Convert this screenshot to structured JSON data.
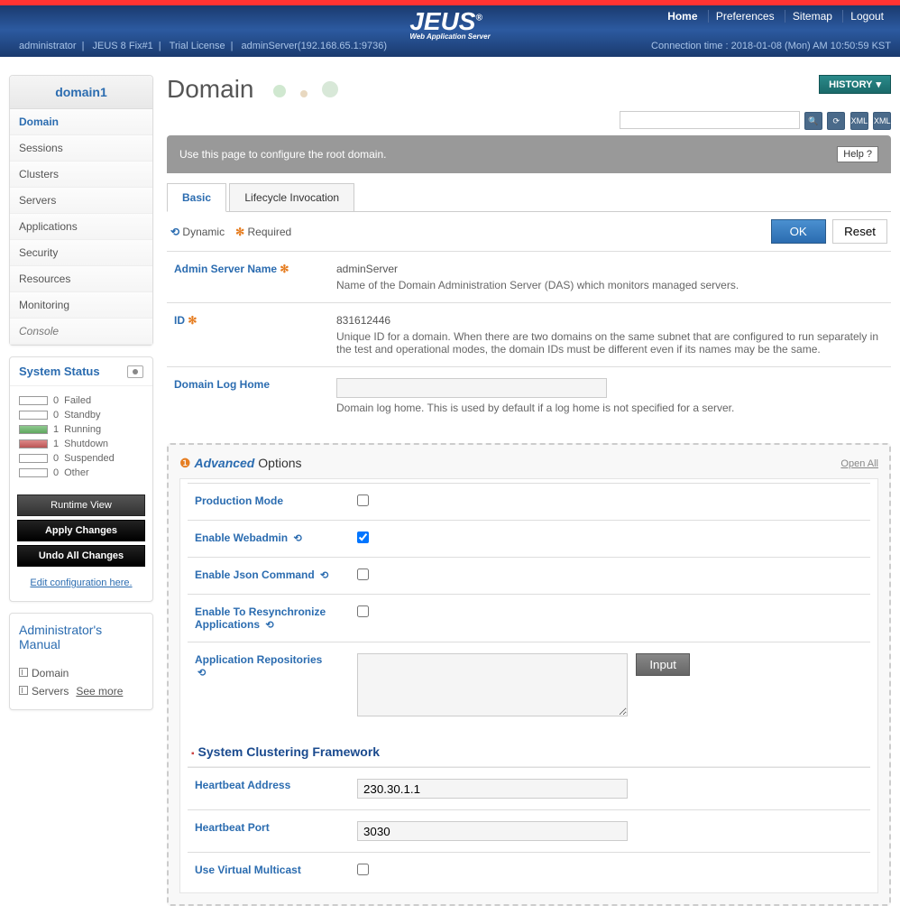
{
  "header": {
    "nav": {
      "home": "Home",
      "preferences": "Preferences",
      "sitemap": "Sitemap",
      "logout": "Logout"
    },
    "logo": "JEUS",
    "logo_sub": "Web Application Server",
    "breadcrumb": {
      "user": "administrator",
      "version": "JEUS 8 Fix#1",
      "license": "Trial License",
      "server": "adminServer(192.168.65.1:9736)"
    },
    "conn_time": "Connection time : 2018-01-08 (Mon) AM 10:50:59 KST"
  },
  "sidebar": {
    "title": "domain1",
    "items": [
      "Domain",
      "Sessions",
      "Clusters",
      "Servers",
      "Applications",
      "Security",
      "Resources",
      "Monitoring",
      "Console"
    ],
    "system_status": {
      "title": "System Status",
      "rows": [
        {
          "count": "0",
          "label": "Failed",
          "color": ""
        },
        {
          "count": "0",
          "label": "Standby",
          "color": ""
        },
        {
          "count": "1",
          "label": "Running",
          "color": "sw-green"
        },
        {
          "count": "1",
          "label": "Shutdown",
          "color": "sw-red"
        },
        {
          "count": "0",
          "label": "Suspended",
          "color": ""
        },
        {
          "count": "0",
          "label": "Other",
          "color": ""
        }
      ]
    },
    "buttons": {
      "runtime": "Runtime View",
      "apply": "Apply Changes",
      "undo": "Undo All Changes"
    },
    "edit_link": "Edit configuration here.",
    "manual": {
      "title": "Administrator's Manual",
      "domain": "Domain",
      "servers": "Servers",
      "see_more": "See more"
    }
  },
  "main": {
    "title": "Domain",
    "history": "HISTORY",
    "description": "Use this page to configure the root domain.",
    "help": "Help",
    "tabs": {
      "basic": "Basic",
      "lifecycle": "Lifecycle Invocation"
    },
    "legend": {
      "dynamic": "Dynamic",
      "required": "Required"
    },
    "actions": {
      "ok": "OK",
      "reset": "Reset"
    },
    "fields": {
      "admin_server_name": {
        "label": "Admin Server Name",
        "value": "adminServer",
        "help": "Name of the Domain Administration Server (DAS) which monitors managed servers."
      },
      "id": {
        "label": "ID",
        "value": "831612446",
        "help": "Unique ID for a domain. When there are two domains on the same subnet that are configured to run separately in the test and operational modes, the domain IDs must be different even if its names may be the same."
      },
      "domain_log_home": {
        "label": "Domain Log Home",
        "value": "",
        "help": "Domain log home. This is used by default if a log home is not specified for a server."
      }
    },
    "advanced": {
      "title_prefix": "Advanced",
      "title_suffix": " Options",
      "open_all": "Open All",
      "production_mode": {
        "label": "Production Mode",
        "checked": false
      },
      "enable_webadmin": {
        "label": "Enable Webadmin",
        "checked": true
      },
      "enable_json": {
        "label": "Enable Json Command",
        "checked": false
      },
      "enable_resync": {
        "label": "Enable To Resynchronize Applications",
        "checked": false
      },
      "app_repos": {
        "label": "Application Repositories",
        "value": "",
        "input_btn": "Input"
      },
      "clustering": {
        "title": "System Clustering Framework",
        "heartbeat_addr": {
          "label": "Heartbeat Address",
          "value": "230.30.1.1"
        },
        "heartbeat_port": {
          "label": "Heartbeat Port",
          "value": "3030"
        },
        "use_virtual": {
          "label": "Use Virtual Multicast",
          "checked": false
        }
      }
    }
  }
}
